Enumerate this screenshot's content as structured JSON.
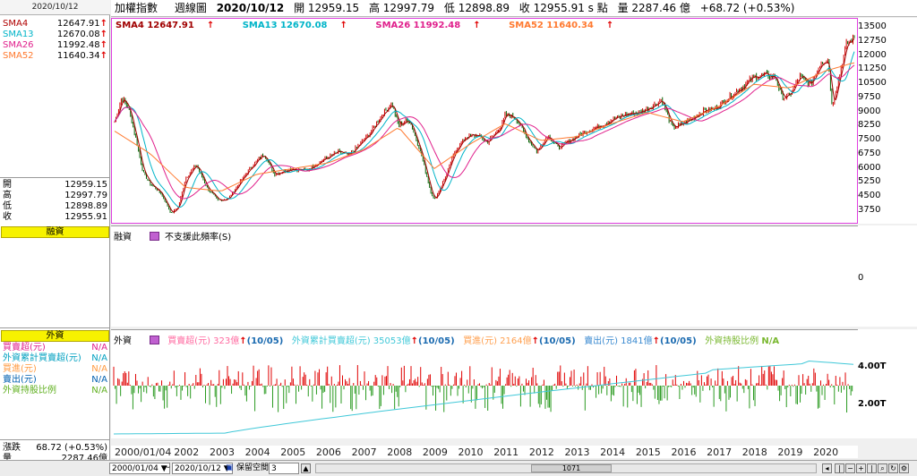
{
  "left_panel": {
    "date": "2020/10/12",
    "sma": [
      {
        "label": "SMA4",
        "value": "12647.91",
        "color": "#b00000"
      },
      {
        "label": "SMA13",
        "value": "12670.08",
        "color": "#00b4c8"
      },
      {
        "label": "SMA26",
        "value": "11992.48",
        "color": "#e0208c"
      },
      {
        "label": "SMA52",
        "value": "11640.34",
        "color": "#ff7a30"
      }
    ],
    "ohlc": [
      {
        "label": "開",
        "value": "12959.15"
      },
      {
        "label": "高",
        "value": "12997.79"
      },
      {
        "label": "低",
        "value": "12898.89"
      },
      {
        "label": "收",
        "value": "12955.91"
      }
    ],
    "margin_title": "融資",
    "foreign_title": "外資",
    "foreign_rows": [
      {
        "label": "買賣超(元)",
        "value": "N/A",
        "color": "#e0208c"
      },
      {
        "label": "外資累計買賣超(元)",
        "value": "N/A",
        "color": "#00a0c0"
      },
      {
        "label": "買進(元)",
        "value": "N/A",
        "color": "#ff9a40"
      },
      {
        "label": "賣出(元)",
        "value": "N/A",
        "color": "#0060b0"
      },
      {
        "label": "外資持股比例",
        "value": "N/A",
        "color": "#60b020"
      }
    ],
    "change_label": "漲跌",
    "change_value": "68.72 (+0.53%)",
    "volume_label": "量",
    "volume_value": "2287.46億"
  },
  "header": {
    "index_name": "加權指數",
    "period": "週線圖",
    "date": "2020/10/12",
    "open": "開 12959.15",
    "high": "高 12997.79",
    "low": "低 12898.89",
    "close": "收 12955.91 s 點",
    "volume": "量 2287.46 億",
    "change": "+68.72 (+0.53%)"
  },
  "price_panel": {
    "legend": [
      {
        "text": "SMA4 12647.91",
        "color": "#a00000"
      },
      {
        "text": "SMA13 12670.08",
        "color": "#00b4c8"
      },
      {
        "text": "SMA26 11992.48",
        "color": "#e0208c"
      },
      {
        "text": "SMA52 11640.34",
        "color": "#ff7a30"
      }
    ],
    "y_ticks": [
      "13500",
      "12750",
      "12000",
      "11250",
      "10500",
      "9750",
      "9000",
      "8250",
      "7500",
      "6750",
      "6000",
      "5250",
      "4500",
      "3750"
    ]
  },
  "margin_panel": {
    "label": "融資",
    "note": "不支援此頻率(S)",
    "y_tick": "0"
  },
  "foreign_panel": {
    "label": "外資",
    "legend": [
      {
        "text": "買賣超(元) 323億",
        "date": "(10/05)",
        "color": "#ff6aa0"
      },
      {
        "text": "外資累計買賣超(元) 35053億",
        "date": "(10/05)",
        "color": "#40c8d8"
      },
      {
        "text": "買進(元) 2164億",
        "date": "(10/05)",
        "color": "#ffa050"
      },
      {
        "text": "賣出(元) 1841億",
        "date": "(10/05)",
        "color": "#3a8ad0"
      },
      {
        "text": "外資持股比例",
        "date": "N/A",
        "color": "#7ab830"
      }
    ],
    "y_ticks": [
      "4.00T",
      "2.00T"
    ]
  },
  "x_axis": {
    "labels": [
      "2000/01/04",
      "2002",
      "2003",
      "2004",
      "2005",
      "2006",
      "2007",
      "2008",
      "2009",
      "2010",
      "2011",
      "2012",
      "2013",
      "2014",
      "2015",
      "2016",
      "2017",
      "2018",
      "2019",
      "2020"
    ]
  },
  "bottom_bar": {
    "start_date": "2000/01/04",
    "end_date": "2020/10/12",
    "keep_space_label": "保留空間",
    "keep_space_value": "3",
    "scroll_value": "1071"
  },
  "chart_data": {
    "type": "line",
    "title": "加權指數 週線圖",
    "x_range": [
      "2000/01/04",
      "2020/10/12"
    ],
    "ylim": [
      3400,
      13800
    ],
    "series": [
      {
        "name": "收",
        "x": [
          2000.0,
          2000.2,
          2000.4,
          2000.6,
          2000.8,
          2001.0,
          2001.3,
          2001.6,
          2001.8,
          2002.0,
          2002.3,
          2002.6,
          2002.9,
          2003.2,
          2003.5,
          2003.8,
          2004.0,
          2004.2,
          2004.5,
          2004.8,
          2005.0,
          2005.4,
          2005.8,
          2006.0,
          2006.3,
          2006.6,
          2006.9,
          2007.2,
          2007.5,
          2007.8,
          2008.0,
          2008.3,
          2008.6,
          2008.9,
          2009.0,
          2009.3,
          2009.6,
          2009.9,
          2010.2,
          2010.5,
          2010.9,
          2011.0,
          2011.3,
          2011.6,
          2011.9,
          2012.2,
          2012.5,
          2012.9,
          2013.3,
          2013.7,
          2014.0,
          2014.4,
          2014.8,
          2015.2,
          2015.4,
          2015.7,
          2015.9,
          2016.2,
          2016.6,
          2016.9,
          2017.3,
          2017.7,
          2018.0,
          2018.3,
          2018.6,
          2018.8,
          2019.0,
          2019.3,
          2019.6,
          2019.9,
          2020.1,
          2020.2,
          2020.4,
          2020.6,
          2020.8
        ],
        "y": [
          8500,
          9800,
          9200,
          7600,
          5800,
          5200,
          4700,
          3600,
          4000,
          5500,
          6200,
          5000,
          4300,
          4400,
          5200,
          6000,
          6400,
          6800,
          5700,
          5900,
          6000,
          5900,
          6400,
          6600,
          6900,
          6700,
          7300,
          7900,
          8800,
          9500,
          8300,
          8600,
          7000,
          4800,
          4300,
          5500,
          7000,
          7700,
          7800,
          7400,
          8300,
          8900,
          8700,
          7700,
          6900,
          7800,
          7100,
          7600,
          8000,
          8300,
          8600,
          8900,
          9000,
          9400,
          9700,
          8200,
          8300,
          8600,
          9100,
          9200,
          9800,
          10400,
          10900,
          11000,
          10900,
          9800,
          9900,
          10900,
          10500,
          11700,
          11800,
          9300,
          10900,
          12600,
          12956
        ]
      },
      {
        "name": "SMA52",
        "x": [
          2000.0,
          2001.0,
          2002.0,
          2003.0,
          2004.0,
          2005.0,
          2006.0,
          2007.0,
          2008.0,
          2009.0,
          2010.0,
          2011.0,
          2012.0,
          2013.0,
          2014.0,
          2015.0,
          2016.0,
          2017.0,
          2018.0,
          2019.0,
          2020.0,
          2020.8
        ],
        "y": [
          8000,
          6800,
          5000,
          4800,
          5700,
          6000,
          6300,
          7000,
          8200,
          6000,
          7300,
          8400,
          7500,
          7700,
          8400,
          9000,
          8500,
          9300,
          10500,
          10300,
          11200,
          11640
        ]
      }
    ]
  }
}
